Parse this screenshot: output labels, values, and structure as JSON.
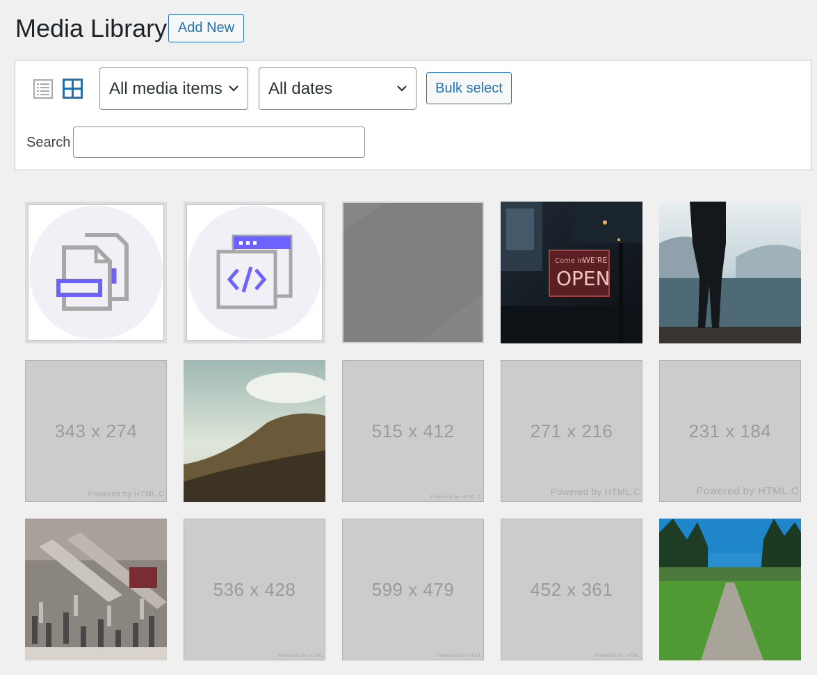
{
  "header": {
    "title": "Media Library",
    "add_new_label": "Add New"
  },
  "toolbar": {
    "view_list_icon": "list-view-icon",
    "view_grid_icon": "grid-view-icon",
    "media_filter": {
      "selected": "All media items"
    },
    "date_filter": {
      "selected": "All dates"
    },
    "bulk_select_label": "Bulk select",
    "search_label": "Search",
    "search_value": ""
  },
  "accent_color": "#2271b1",
  "media": [
    {
      "type": "document-icon"
    },
    {
      "type": "code-file-icon"
    },
    {
      "type": "gray-image"
    },
    {
      "type": "photo",
      "subject": "OPEN sign in window",
      "sign_text_small": "Come in",
      "sign_text_we_re": "WE'RE",
      "sign_text_open": "OPEN"
    },
    {
      "type": "photo",
      "subject": "person standing by foggy lake"
    },
    {
      "type": "placeholder",
      "dims": "343 x 274",
      "powered": "Powered by HTML.C"
    },
    {
      "type": "photo",
      "subject": "grassy hillside under cloudy sky"
    },
    {
      "type": "placeholder",
      "dims": "515 x 412",
      "powered": "Powered by HTML.C"
    },
    {
      "type": "placeholder",
      "dims": "271 x 216",
      "powered": "Powered by HTML.C"
    },
    {
      "type": "placeholder",
      "dims": "231 x 184",
      "powered": "Powered by HTML.C"
    },
    {
      "type": "photo",
      "subject": "crowded shopping mall"
    },
    {
      "type": "placeholder",
      "dims": "536 x 428",
      "powered": "Powered by HTML"
    },
    {
      "type": "placeholder",
      "dims": "599 x 479",
      "powered": "Powered by HTML"
    },
    {
      "type": "placeholder",
      "dims": "452 x 361",
      "powered": "Powered by HTML"
    },
    {
      "type": "photo",
      "subject": "gravel path through green park"
    }
  ]
}
